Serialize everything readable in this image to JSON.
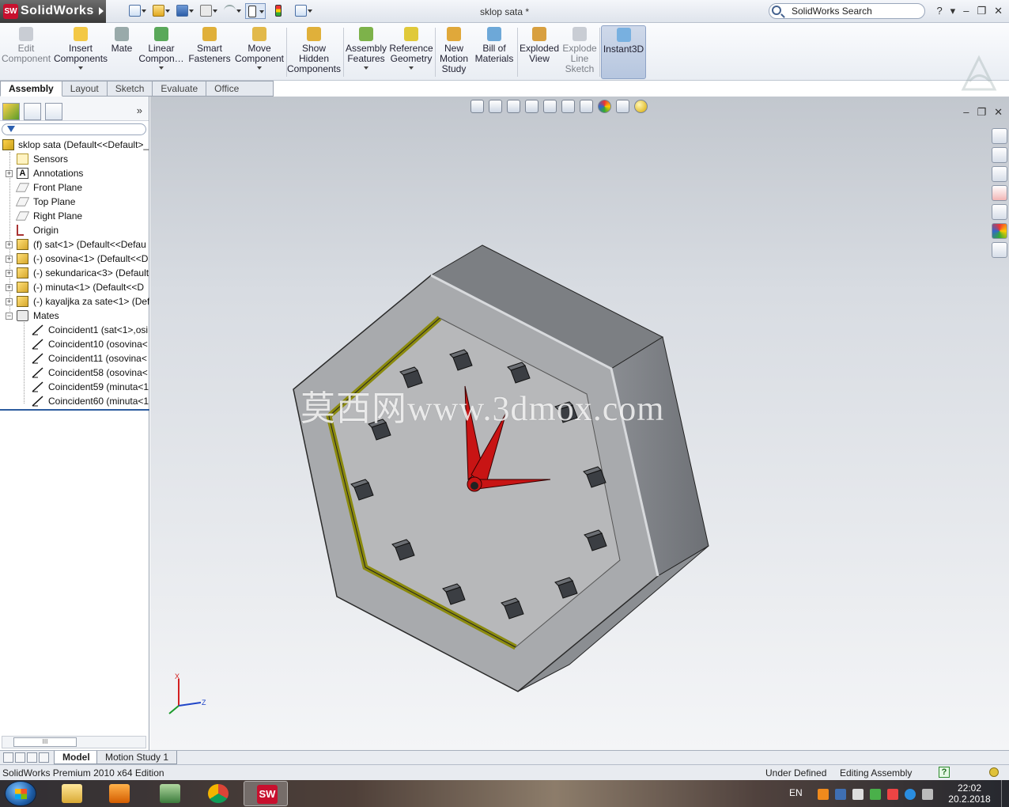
{
  "app": {
    "logo_text": "SolidWorks",
    "document_title": "sklop sata *",
    "search_placeholder": "SolidWorks Search",
    "help_label": "?"
  },
  "command_manager": {
    "items": [
      {
        "label": "Edit\nComponent",
        "icon": "edit-component-icon",
        "enabled": false
      },
      {
        "label": "Insert\nComponents",
        "icon": "insert-components-icon",
        "enabled": true,
        "dropdown": true
      },
      {
        "label": "Mate",
        "icon": "mate-paperclip-icon",
        "enabled": true
      },
      {
        "label": "Linear\nCompon…",
        "icon": "linear-pattern-icon",
        "enabled": true,
        "dropdown": true
      },
      {
        "label": "Smart\nFasteners",
        "icon": "smart-fasteners-icon",
        "enabled": true
      },
      {
        "label": "Move\nComponent",
        "icon": "move-component-icon",
        "enabled": true,
        "dropdown": true
      },
      {
        "label": "Show\nHidden\nComponents",
        "icon": "show-hidden-icon",
        "enabled": true
      },
      {
        "label": "Assembly\nFeatures",
        "icon": "assembly-features-icon",
        "enabled": true,
        "dropdown": true
      },
      {
        "label": "Reference\nGeometry",
        "icon": "reference-geometry-icon",
        "enabled": true,
        "dropdown": true
      },
      {
        "label": "New\nMotion\nStudy",
        "icon": "motion-study-icon",
        "enabled": true
      },
      {
        "label": "Bill of\nMaterials",
        "icon": "bom-icon",
        "enabled": true
      },
      {
        "label": "Exploded\nView",
        "icon": "exploded-view-icon",
        "enabled": true
      },
      {
        "label": "Explode\nLine\nSketch",
        "icon": "explode-line-icon",
        "enabled": false
      },
      {
        "label": "Instant3D",
        "icon": "instant3d-icon",
        "enabled": true,
        "active": true
      }
    ]
  },
  "tabs": [
    "Assembly",
    "Layout",
    "Sketch",
    "Evaluate",
    "Office Products"
  ],
  "active_tab": "Assembly",
  "feature_tree": {
    "root": "sklop sata  (Default<<Default>_",
    "items": [
      {
        "label": "Sensors",
        "icon": "sensors-icon",
        "expand": false
      },
      {
        "label": "Annotations",
        "icon": "annotations-icon",
        "expand": true
      },
      {
        "label": "Front Plane",
        "icon": "plane-icon",
        "expand": false
      },
      {
        "label": "Top Plane",
        "icon": "plane-icon",
        "expand": false
      },
      {
        "label": "Right Plane",
        "icon": "plane-icon",
        "expand": false
      },
      {
        "label": "Origin",
        "icon": "origin-icon",
        "expand": false
      },
      {
        "label": "(f) sat<1> (Default<<Defau",
        "icon": "part-icon",
        "expand": true
      },
      {
        "label": "(-) osovina<1> (Default<<D",
        "icon": "part-icon",
        "expand": true
      },
      {
        "label": "(-) sekundarica<3> (Default",
        "icon": "part-icon",
        "expand": true
      },
      {
        "label": "(-) minuta<1> (Default<<D",
        "icon": "part-icon",
        "expand": true
      },
      {
        "label": "(-) kayaljka za sate<1> (Def",
        "icon": "part-icon",
        "expand": true
      },
      {
        "label": "Mates",
        "icon": "mates-folder-icon",
        "expand": "open"
      }
    ],
    "mates": [
      "Coincident1 (sat<1>,osi",
      "Coincident10 (osovina<",
      "Coincident11 (osovina<",
      "Coincident58 (osovina<",
      "Coincident59 (minuta<1",
      "Coincident60 (minuta<1"
    ],
    "scroll_thumb": "III"
  },
  "graphics": {
    "watermark": "莫西网www.3dmox.com",
    "triad": {
      "x": "X",
      "z": "Z"
    }
  },
  "bottom_tabs": [
    "Model",
    "Motion Study 1"
  ],
  "status_bar": {
    "edition": "SolidWorks Premium 2010 x64 Edition",
    "state": "Under Defined",
    "mode": "Editing Assembly"
  },
  "taskbar": {
    "lang": "EN",
    "time": "22:02",
    "date": "20.2.2018",
    "apps": [
      "explorer-icon",
      "media-player-icon",
      "remote-desktop-icon",
      "chrome-icon",
      "solidworks-icon"
    ]
  },
  "colors": {
    "brand_red": "#c8102e",
    "clock_hand_red": "#c81414",
    "bezel_olive": "#8b8a0e",
    "status_bar": "#e8ebf0"
  }
}
